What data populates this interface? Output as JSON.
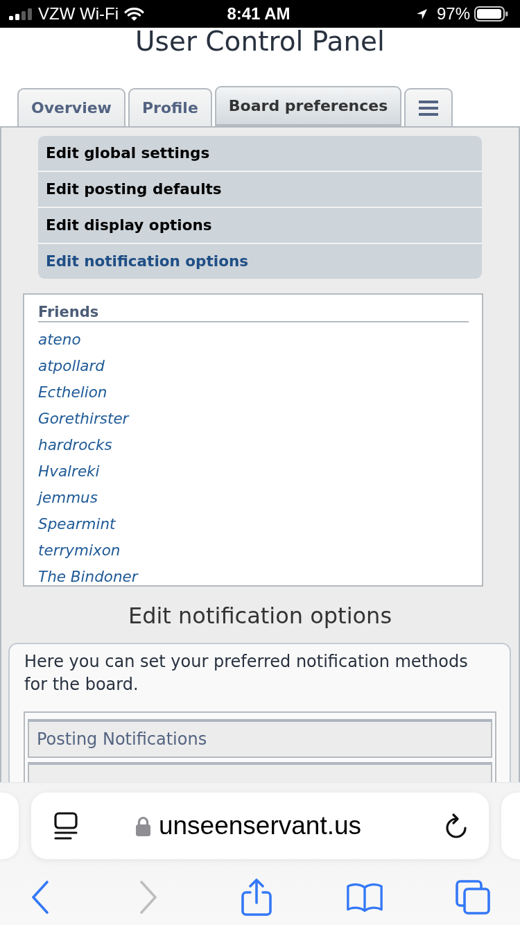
{
  "status_bar": {
    "carrier": "VZW Wi-Fi",
    "time": "8:41 AM",
    "battery": "97%"
  },
  "page_title": "User Control Panel",
  "tabs": [
    {
      "kind": "text",
      "label": "Overview",
      "selected": false
    },
    {
      "kind": "text",
      "label": "Profile",
      "selected": false
    },
    {
      "kind": "text",
      "label": "Board preferences",
      "selected": true
    },
    {
      "kind": "menu",
      "selected": false
    }
  ],
  "submenu": [
    {
      "label": "Edit global settings",
      "selected": false
    },
    {
      "label": "Edit posting defaults",
      "selected": false
    },
    {
      "label": "Edit display options",
      "selected": false
    },
    {
      "label": "Edit notification options",
      "selected": true
    }
  ],
  "friends": {
    "heading": "Friends",
    "items": [
      "ateno",
      "atpollard",
      "Ecthelion",
      "Gorethirster",
      "hardrocks",
      "Hvalreki",
      "jemmus",
      "Spearmint",
      "terrymixon",
      "The Bindoner"
    ]
  },
  "section": {
    "heading": "Edit notification options",
    "description": "Here you can set your preferred notification methods for the board.",
    "table": {
      "rows": [
        {
          "kind": "header",
          "label": "Posting Notifications"
        },
        {
          "kind": "row"
        }
      ]
    }
  },
  "browser": {
    "url": "unseenservant.us",
    "nav": [
      {
        "kind": "back",
        "disabled": false
      },
      {
        "kind": "forward",
        "disabled": true
      },
      {
        "kind": "share",
        "disabled": false
      },
      {
        "kind": "bookmarks",
        "disabled": false
      },
      {
        "kind": "tabs",
        "disabled": false
      }
    ]
  }
}
